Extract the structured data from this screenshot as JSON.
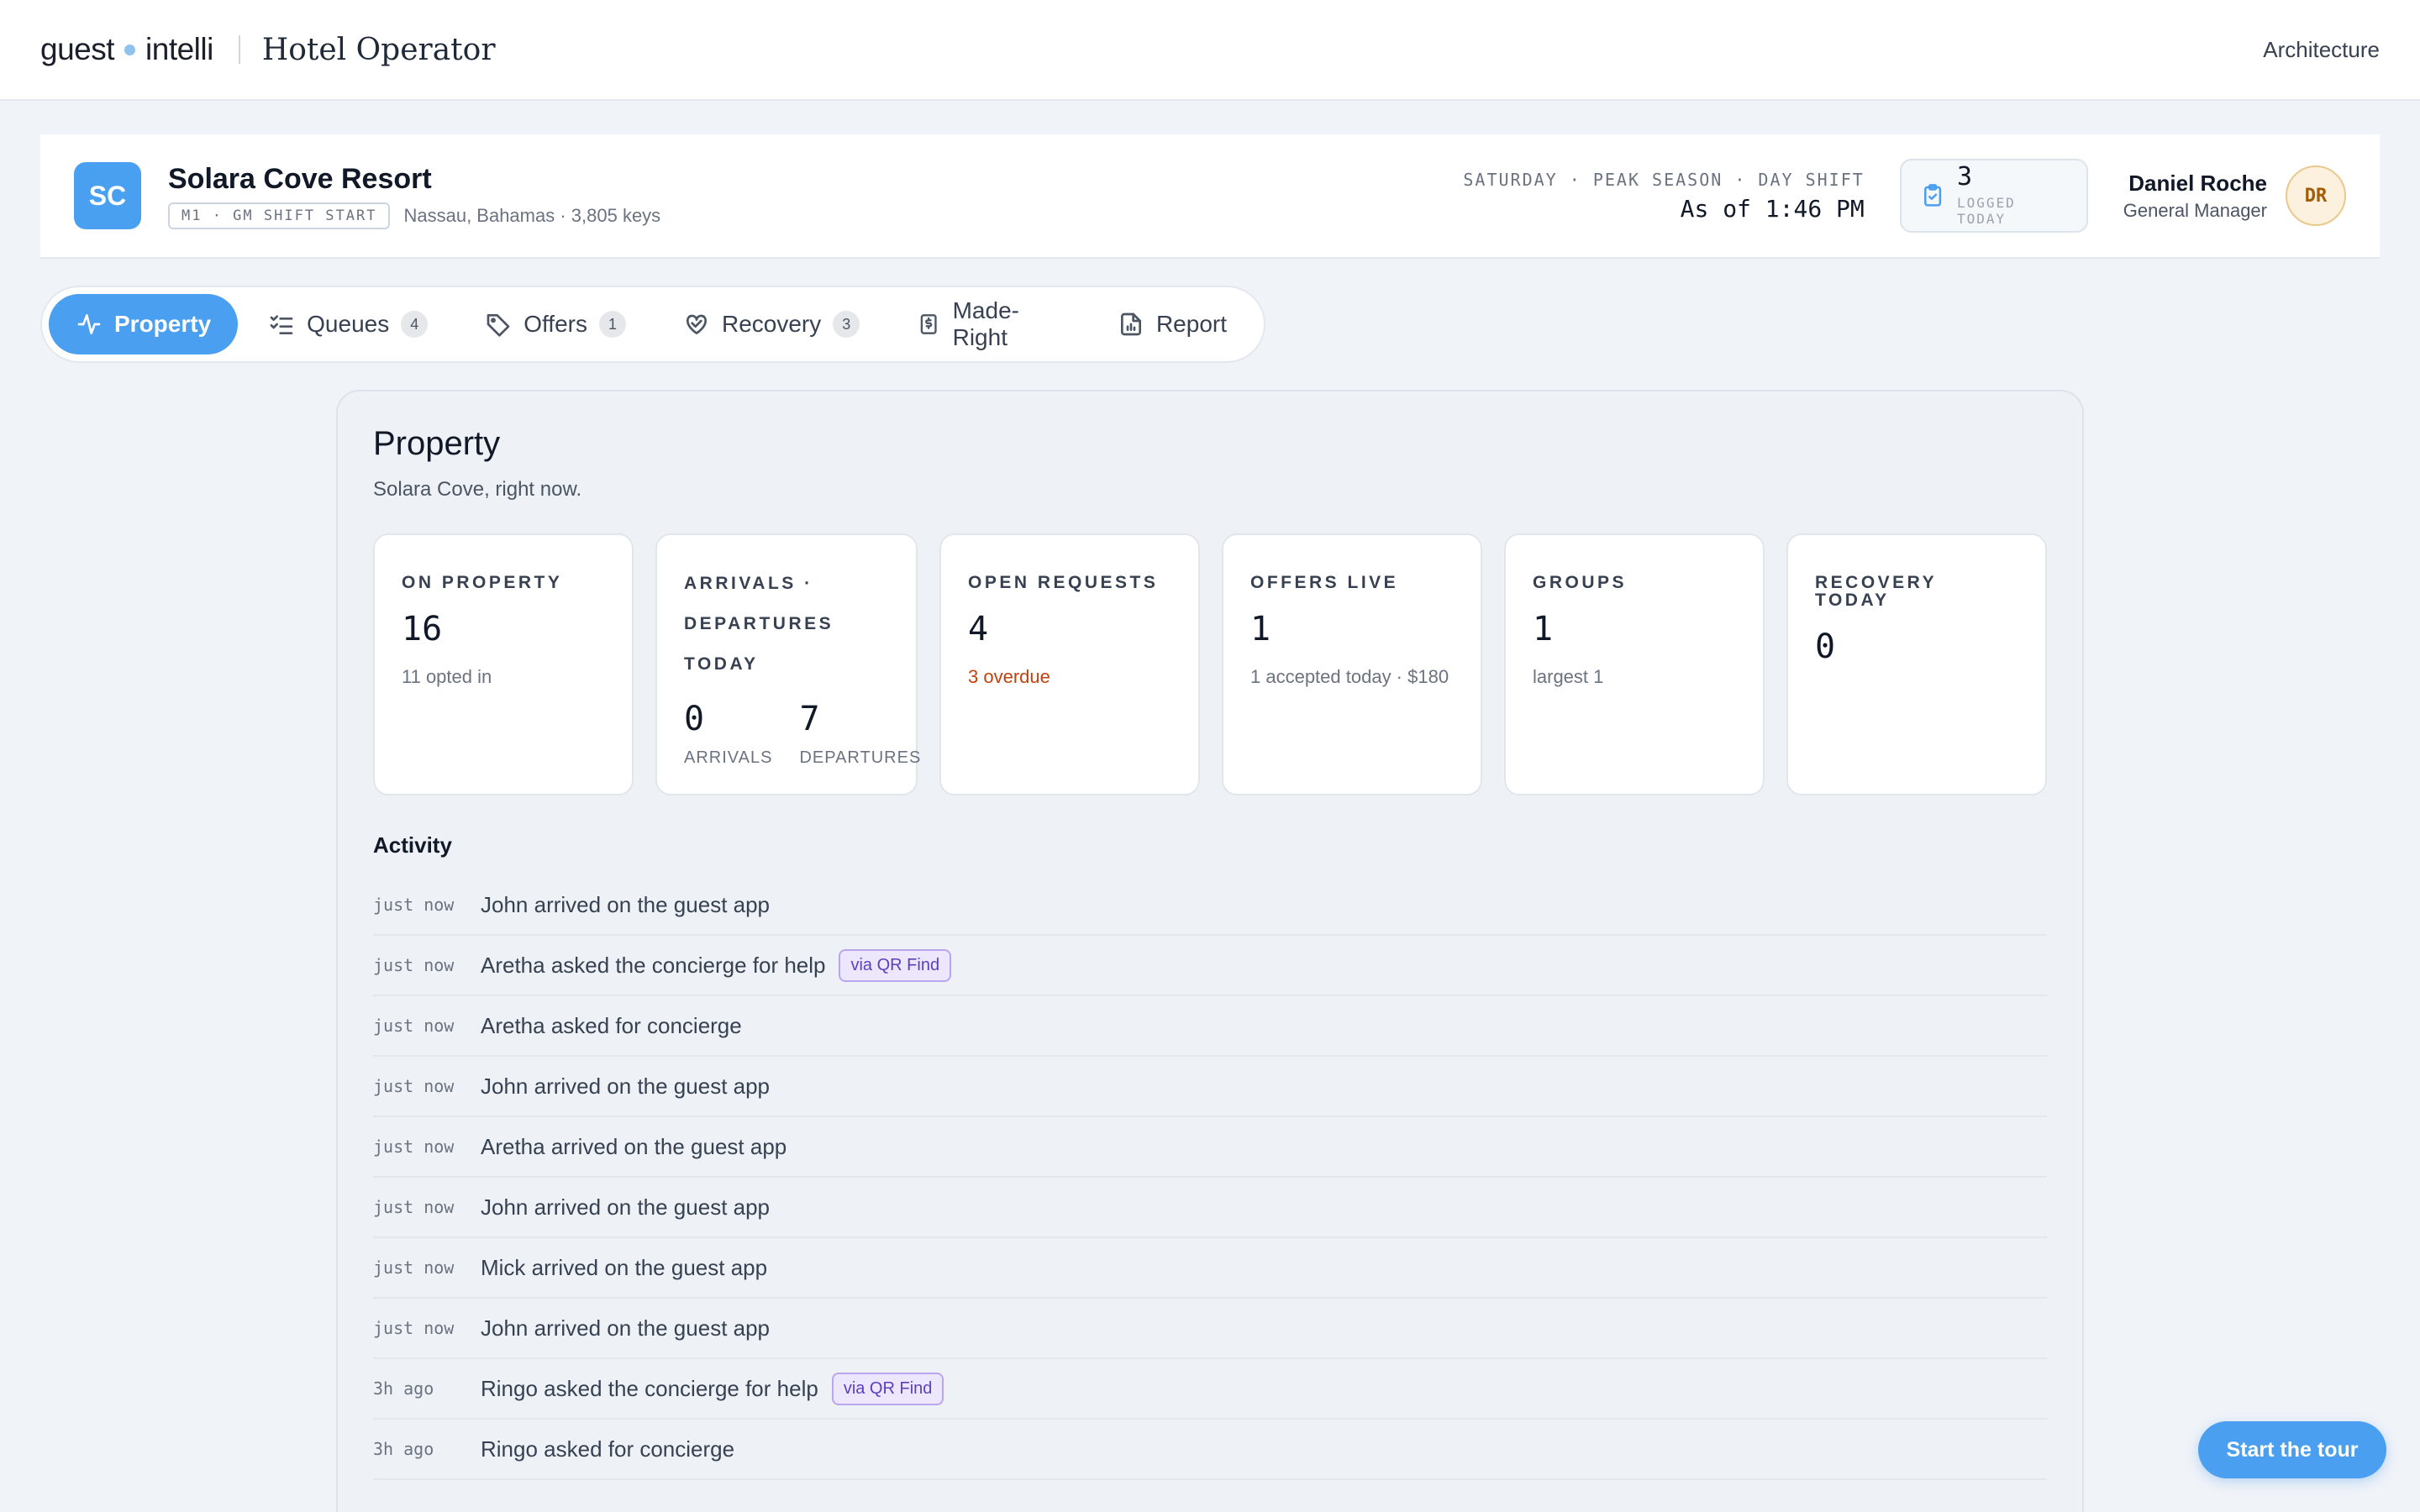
{
  "topbar": {
    "brand_left": "guest",
    "brand_right": "intelli",
    "product": "Hotel Operator",
    "link": "Architecture"
  },
  "property": {
    "initials": "SC",
    "name": "Solara Cove Resort",
    "shift_tag": "M1 · GM SHIFT START",
    "location": "Nassau, Bahamas · 3,805 keys",
    "shift_line": "SATURDAY · PEAK SEASON · DAY SHIFT",
    "as_of": "As of 1:46 PM",
    "logged_count": "3",
    "logged_label": "LOGGED TODAY",
    "user_name": "Daniel Roche",
    "user_role": "General Manager",
    "user_initials": "DR"
  },
  "tabs": [
    {
      "label": "Property",
      "icon": "activity-icon",
      "count": null
    },
    {
      "label": "Queues",
      "icon": "checklist-icon",
      "count": "4"
    },
    {
      "label": "Offers",
      "icon": "tag-icon",
      "count": "1"
    },
    {
      "label": "Recovery",
      "icon": "heart-handshake-icon",
      "count": "3"
    },
    {
      "label": "Made-Right",
      "icon": "receipt-icon",
      "count": null
    },
    {
      "label": "Report",
      "icon": "file-chart-icon",
      "count": null
    }
  ],
  "panel": {
    "title": "Property",
    "subtitle": "Solara Cove, right now."
  },
  "stats": {
    "on_property": {
      "label": "ON PROPERTY",
      "value": "16",
      "note": "11 opted in"
    },
    "arrivals": {
      "label_1": "ARRIVALS ·",
      "label_2": "DEPARTURES",
      "label_3": "TODAY",
      "arrivals_value": "0",
      "arrivals_label": "ARRIVALS",
      "departures_value": "7",
      "departures_label": "DEPARTURES"
    },
    "open_requests": {
      "label": "OPEN REQUESTS",
      "value": "4",
      "note": "3 overdue"
    },
    "offers_live": {
      "label": "OFFERS LIVE",
      "value": "1",
      "note": "1 accepted today · $180"
    },
    "groups": {
      "label": "GROUPS",
      "value": "1",
      "note": "largest 1"
    },
    "recovery_today": {
      "label": "RECOVERY TODAY",
      "value": "0"
    }
  },
  "activity": {
    "title": "Activity",
    "rows": [
      {
        "time": "just now",
        "text": "John arrived on the guest app",
        "tag": null
      },
      {
        "time": "just now",
        "text": "Aretha asked the concierge for help",
        "tag": "via QR Find"
      },
      {
        "time": "just now",
        "text": "Aretha asked for concierge",
        "tag": null
      },
      {
        "time": "just now",
        "text": "John arrived on the guest app",
        "tag": null
      },
      {
        "time": "just now",
        "text": "Aretha arrived on the guest app",
        "tag": null
      },
      {
        "time": "just now",
        "text": "John arrived on the guest app",
        "tag": null
      },
      {
        "time": "just now",
        "text": "Mick arrived on the guest app",
        "tag": null
      },
      {
        "time": "just now",
        "text": "John arrived on the guest app",
        "tag": null
      },
      {
        "time": "3h ago",
        "text": "Ringo asked the concierge for help",
        "tag": "via QR Find"
      },
      {
        "time": "3h ago",
        "text": "Ringo asked for concierge",
        "tag": null
      }
    ]
  },
  "tour_button": "Start the tour",
  "colors": {
    "accent": "#4a9ff0",
    "warning": "#c2410c",
    "tag_purple": "#5b3fbf"
  }
}
